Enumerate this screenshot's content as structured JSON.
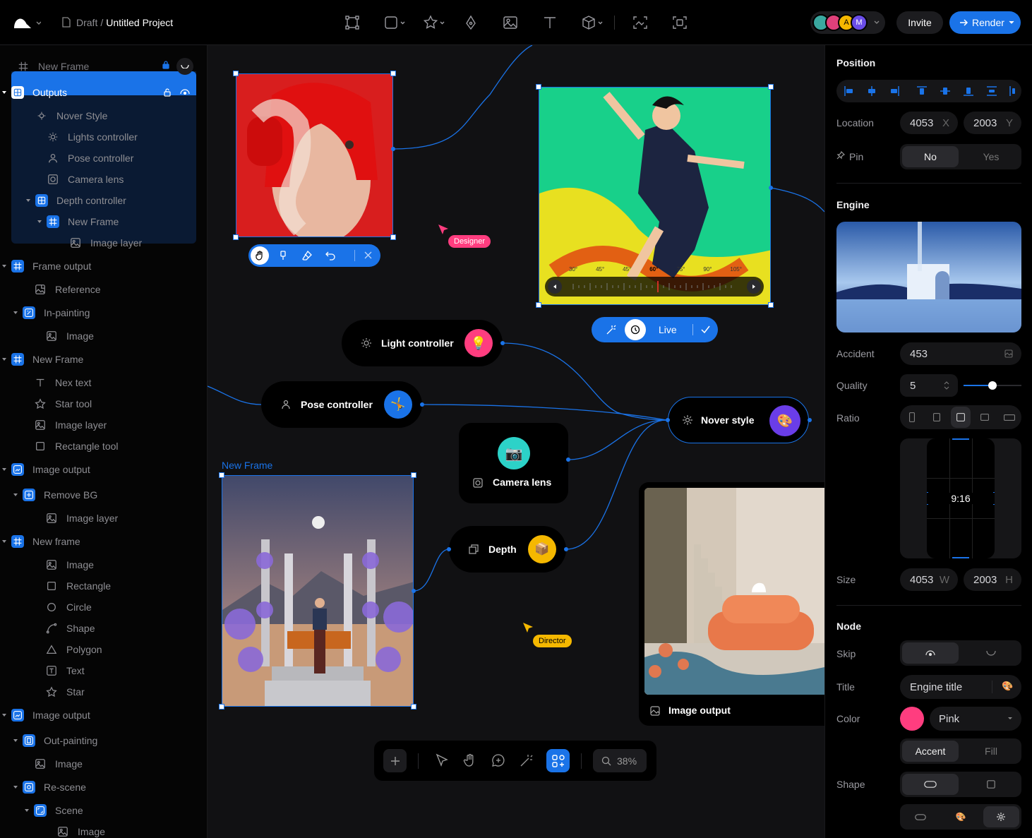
{
  "topbar": {
    "breadcrumb_parent": "Draft",
    "breadcrumb_sep": "/",
    "project_title": "Untitled Project",
    "avatars": [
      "A",
      "M"
    ],
    "invite_label": "Invite",
    "render_label": "Render"
  },
  "layers": {
    "items": [
      {
        "label": "New Frame"
      },
      {
        "label": "Outputs"
      },
      {
        "label": "Nover Style"
      },
      {
        "label": "Lights controller"
      },
      {
        "label": "Pose controller"
      },
      {
        "label": "Camera lens"
      },
      {
        "label": "Depth controller"
      },
      {
        "label": "New Frame"
      },
      {
        "label": "Image layer"
      },
      {
        "label": "Frame output"
      },
      {
        "label": "Reference"
      },
      {
        "label": "In-painting"
      },
      {
        "label": "Image"
      },
      {
        "label": "New Frame"
      },
      {
        "label": "Nex text"
      },
      {
        "label": "Star tool"
      },
      {
        "label": "Image layer"
      },
      {
        "label": "Rectangle tool"
      },
      {
        "label": "Image output"
      },
      {
        "label": "Remove BG"
      },
      {
        "label": "Image layer"
      },
      {
        "label": "New frame"
      },
      {
        "label": "Image"
      },
      {
        "label": "Rectangle"
      },
      {
        "label": "Circle"
      },
      {
        "label": "Shape"
      },
      {
        "label": "Polygon"
      },
      {
        "label": "Text"
      },
      {
        "label": "Star"
      },
      {
        "label": "Image output"
      },
      {
        "label": "Out-painting"
      },
      {
        "label": "Image"
      },
      {
        "label": "Re-scene"
      },
      {
        "label": "Scene"
      },
      {
        "label": "Image"
      }
    ]
  },
  "canvas": {
    "cursor_designer": "Designer",
    "cursor_director": "Director",
    "frame_label": "New Frame",
    "live_label": "Live",
    "angle_ticks": [
      "30°",
      "45°",
      "45°",
      "60°",
      "75°",
      "90°",
      "105°"
    ],
    "nodes": {
      "light": "Light controller",
      "pose": "Pose controller",
      "camera": "Camera lens",
      "nover": "Nover style",
      "depth": "Depth",
      "image_output": "Image output"
    },
    "zoom": "38%"
  },
  "props": {
    "position_title": "Position",
    "location_label": "Location",
    "location_x": "4053",
    "location_x_unit": "X",
    "location_y": "2003",
    "location_y_unit": "Y",
    "pin_label": "Pin",
    "pin_no": "No",
    "pin_yes": "Yes",
    "engine_title": "Engine",
    "accident_label": "Accident",
    "accident_value": "453",
    "quality_label": "Quality",
    "quality_value": "5",
    "quality_slider": 0.5,
    "ratio_label": "Ratio",
    "ratio_preview": "9:16",
    "size_label": "Size",
    "size_w": "4053",
    "size_w_unit": "W",
    "size_h": "2003",
    "size_h_unit": "H",
    "node_title": "Node",
    "skip_label": "Skip",
    "title_label": "Title",
    "title_value": "Engine title",
    "color_label": "Color",
    "color_value": "Pink",
    "color_hex": "#ff3d7f",
    "accent_label": "Accent",
    "fill_label": "Fill",
    "shape_label": "Shape"
  },
  "colors": {
    "accent": "#1a73e8",
    "pink": "#ff3d7f",
    "designer_tag": "#ff3d7f",
    "director_tag": "#f5b800"
  }
}
